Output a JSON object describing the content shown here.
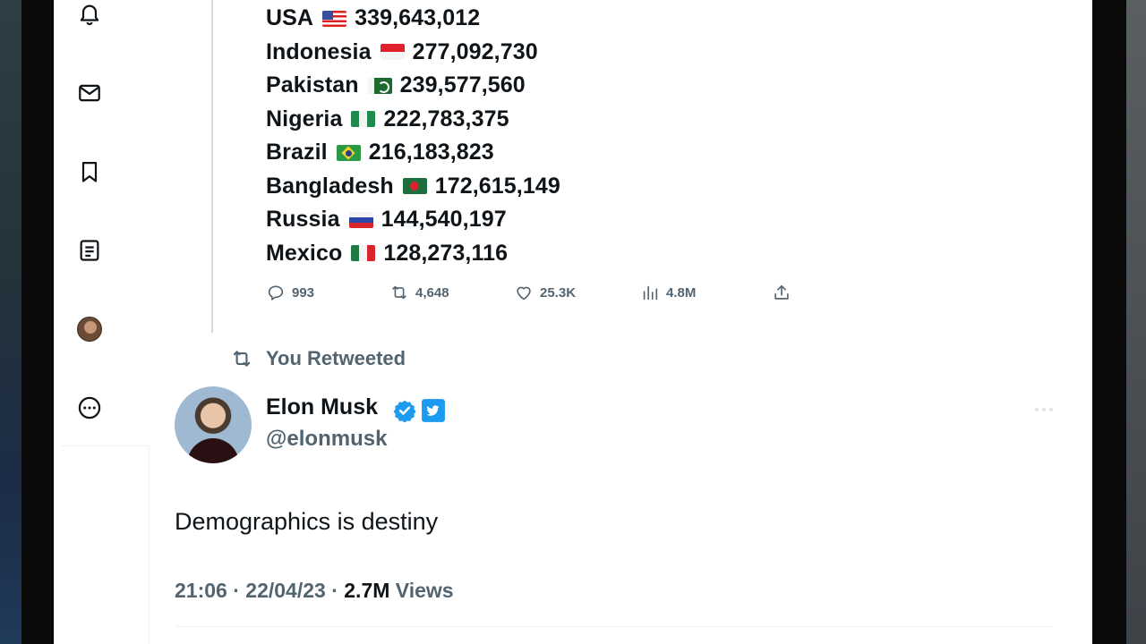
{
  "population_list": [
    {
      "country": "USA",
      "flag": "us-flag",
      "population": "339,643,012"
    },
    {
      "country": "Indonesia",
      "flag": "indonesia-flag",
      "population": "277,092,730"
    },
    {
      "country": "Pakistan",
      "flag": "pakistan-flag",
      "population": "239,577,560"
    },
    {
      "country": "Nigeria",
      "flag": "nigeria-flag",
      "population": "222,783,375"
    },
    {
      "country": "Brazil",
      "flag": "brazil-flag",
      "population": "216,183,823"
    },
    {
      "country": "Bangladesh",
      "flag": "bangladesh-flag",
      "population": "172,615,149"
    },
    {
      "country": "Russia",
      "flag": "russia-flag",
      "population": "144,540,197"
    },
    {
      "country": "Mexico",
      "flag": "mexico-flag",
      "population": "128,273,116"
    }
  ],
  "actions": {
    "replies": "993",
    "retweets": "4,648",
    "likes": "25.3K",
    "views": "4.8M"
  },
  "sidebar": {
    "icons": [
      "bell-icon",
      "mail-icon",
      "bookmark-icon",
      "lists-icon",
      "profile-avatar",
      "more-circle-icon"
    ]
  },
  "retweet_label": "You Retweeted",
  "tweet": {
    "author_name": "Elon Musk",
    "handle": "@elonmusk",
    "text": "Demographics is destiny",
    "time": "21:06",
    "date": "22/04/23",
    "separator": "·",
    "views_count": "2.7M",
    "views_label": "Views"
  },
  "colors": {
    "text_primary": "#0f1419",
    "text_secondary": "#536471",
    "verified_blue": "#1d9bf0"
  }
}
